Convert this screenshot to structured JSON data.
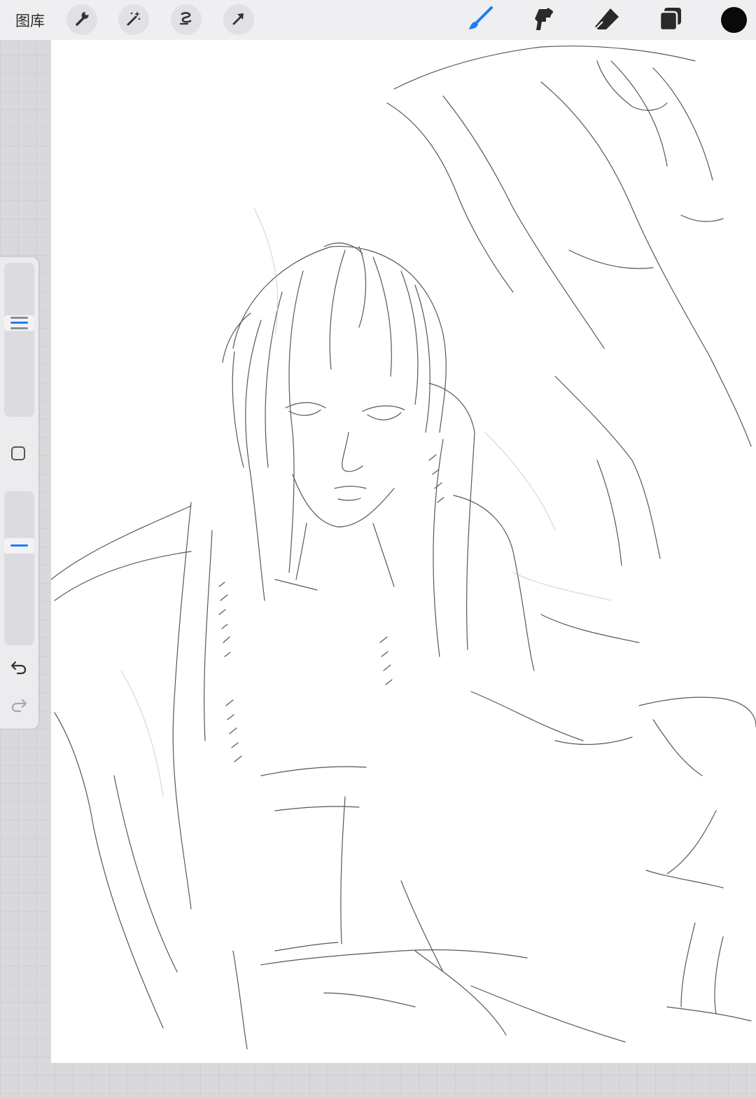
{
  "toolbar": {
    "gallery_label": "图库",
    "left_tools": [
      "wrench-icon",
      "magic-wand-icon",
      "selection-icon",
      "transform-arrow-icon"
    ],
    "right_tools": [
      "brush-icon",
      "smudge-icon",
      "eraser-icon",
      "layers-icon"
    ],
    "active_tool": "brush-icon",
    "current_color": "#0a0a0a",
    "accent_color": "#1e7cf2"
  },
  "sidebar": {
    "brush_size_level": 0.62,
    "opacity_level": 0.66,
    "controls": [
      "brush-size-slider",
      "modify-button",
      "opacity-slider",
      "undo-button",
      "redo-button"
    ]
  }
}
